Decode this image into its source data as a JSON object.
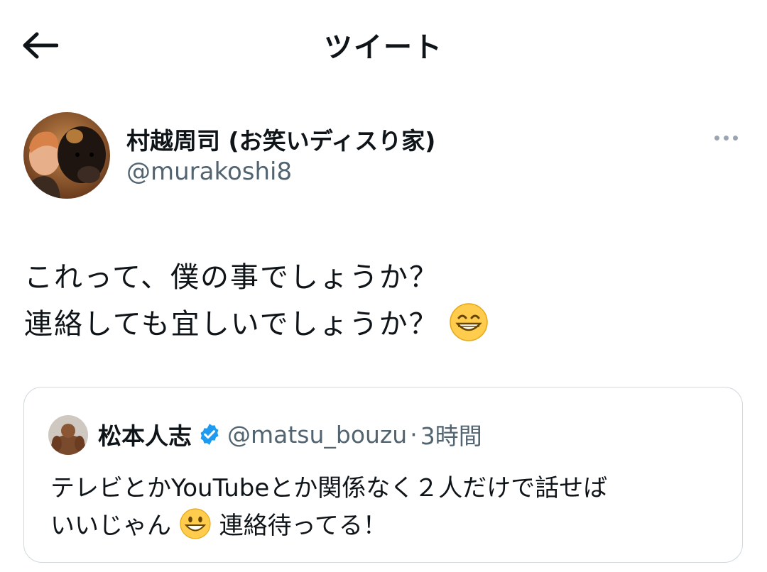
{
  "header": {
    "title": "ツイート",
    "back_icon": "arrow-left-icon"
  },
  "tweet": {
    "author": {
      "display_name": "村越周司 (お笑いディスり家)",
      "handle": "@murakoshi8"
    },
    "more_icon": "more-horizontal-icon",
    "text_line_1": "これって、僕の事でしょうか？",
    "text_line_2": "連絡しても宜しいでしょうか？",
    "text_line_2_emoji": "grinning-face-with-smiling-eyes"
  },
  "quote": {
    "author": {
      "display_name": "松本人志",
      "handle": "@matsu_bouzu",
      "verified": true
    },
    "separator": "·",
    "time": "3時間",
    "text_line_1": "テレビとかYouTubeとか関係なく２人だけで話せば",
    "text_line_2_a": "いいじゃん",
    "text_line_2_emoji": "grinning-face",
    "text_line_2_b": "連絡待ってる！"
  },
  "colors": {
    "text": "#0f1419",
    "secondary": "#536471",
    "border": "#cfd9de",
    "verified": "#1d9bf0"
  }
}
